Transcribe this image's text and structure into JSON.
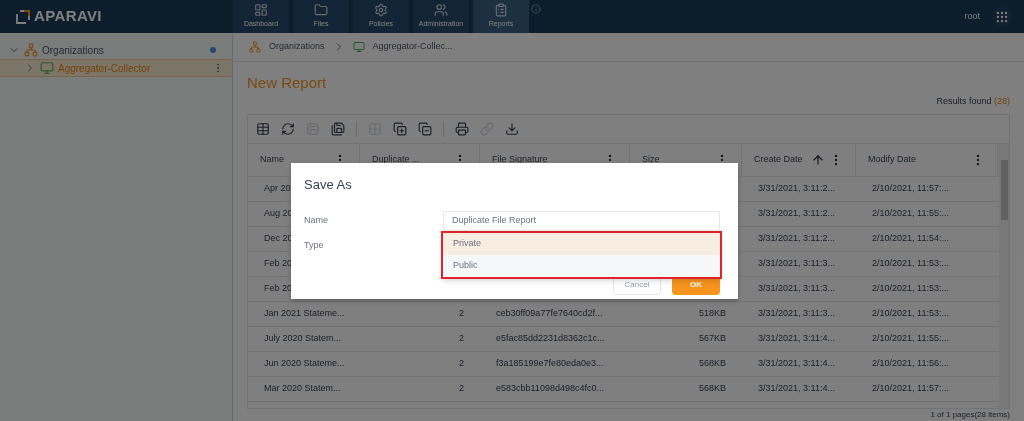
{
  "header": {
    "logo": "APARAVI",
    "nav": [
      {
        "label": "Dashboard",
        "selected": false
      },
      {
        "label": "Files",
        "selected": false
      },
      {
        "label": "Policies",
        "selected": false
      },
      {
        "label": "Administration",
        "selected": false
      },
      {
        "label": "Reports",
        "selected": true
      }
    ],
    "user": "root"
  },
  "sidebar": {
    "tree": [
      {
        "label": "Organizations",
        "expanded": true,
        "selected": false,
        "children": [
          {
            "label": "Aggregator-Collector",
            "expanded": false,
            "selected": true
          }
        ]
      }
    ]
  },
  "breadcrumb": [
    "Organizations",
    "Aggregator-Collec..."
  ],
  "title": "New Report",
  "results": {
    "label": "Results found",
    "count": "(28)"
  },
  "toolbar": [
    {
      "disabled": false
    },
    {
      "disabled": false
    },
    {
      "disabled": true
    },
    {
      "disabled": false
    },
    {
      "disabled": true
    },
    {
      "disabled": false
    },
    {
      "disabled": false
    },
    {
      "disabled": false
    },
    {
      "disabled": true
    },
    {
      "disabled": false
    }
  ],
  "table": {
    "columns": [
      {
        "label": "Name",
        "sorted": false
      },
      {
        "label": "Duplicate ...",
        "sorted": false
      },
      {
        "label": "File Signature",
        "sorted": false
      },
      {
        "label": "Size",
        "sorted": false
      },
      {
        "label": "Create Date",
        "sorted": true
      },
      {
        "label": "Modify Date",
        "sorted": false
      }
    ],
    "rows": [
      [
        "Apr 20",
        "",
        "",
        "",
        "3/31/2021, 3:11:2...",
        "2/10/2021, 11:57:..."
      ],
      [
        "Aug 20",
        "",
        "",
        "",
        "3/31/2021, 3:11:2...",
        "2/10/2021, 11:55:..."
      ],
      [
        "Dec 20",
        "",
        "",
        "",
        "3/31/2021, 3:11:2...",
        "2/10/2021, 11:54:..."
      ],
      [
        "Feb 20",
        "",
        "",
        "",
        "3/31/2021, 3:11:3...",
        "2/10/2021, 11:53:..."
      ],
      [
        "Feb 20",
        "",
        "",
        "",
        "3/31/2021, 3:11:3...",
        "2/10/2021, 11:53:..."
      ],
      [
        "Jan 2021 Stateme...",
        "2",
        "ceb30ff09a77fe7640cd2f...",
        "518KB",
        "3/31/2021, 3:11:3...",
        "2/10/2021, 11:53:..."
      ],
      [
        "July 2020 Statem...",
        "2",
        "e5fac85dd2231d8362c1c...",
        "567KB",
        "3/31/2021, 3:11:4...",
        "2/10/2021, 11:55:..."
      ],
      [
        "Jun 2020 Stateme...",
        "2",
        "f3a185199e7fe80eda0e3...",
        "568KB",
        "3/31/2021, 3:11:4...",
        "2/10/2021, 11:56:..."
      ],
      [
        "Mar 2020 Statem...",
        "2",
        "e583cbb11098d498c4fc0...",
        "568KB",
        "3/31/2021, 3:11:4...",
        "2/10/2021, 11:57:..."
      ]
    ]
  },
  "pager": {
    "summary": "1 of 1 pages(28 items)"
  },
  "dialog": {
    "title": "Save As",
    "fields": [
      {
        "label": "Name",
        "value": "Duplicate File Report"
      },
      {
        "label": "Type"
      }
    ],
    "options": [
      {
        "label": "Private",
        "selected": true
      },
      {
        "label": "Public",
        "selected": false
      }
    ],
    "buttons": [
      {
        "label": "Cancel",
        "kind": "secondary"
      },
      {
        "label": "OK",
        "kind": "primary"
      }
    ]
  }
}
